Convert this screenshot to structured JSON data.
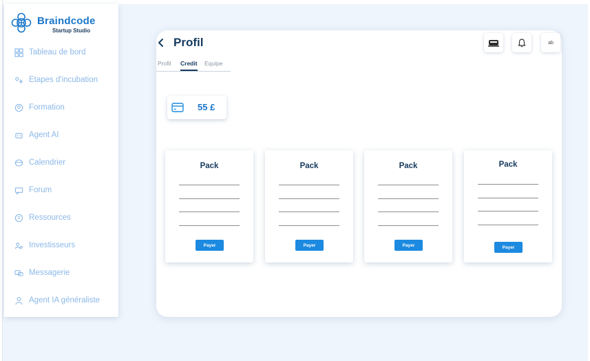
{
  "brand": {
    "name": "Braindcode",
    "subtitle": "Startup Studio",
    "color": "#1976c9"
  },
  "sidebar": {
    "items": [
      {
        "label": "Tableau de bord",
        "icon": "dashboard-icon"
      },
      {
        "label": "Etapes d'incubation",
        "icon": "steps-icon"
      },
      {
        "label": "Formation",
        "icon": "training-icon"
      },
      {
        "label": "Agent AI",
        "icon": "robot-icon"
      },
      {
        "label": "Calendrier",
        "icon": "calendar-icon"
      },
      {
        "label": "Forum",
        "icon": "forum-icon"
      },
      {
        "label": "Ressources",
        "icon": "document-icon"
      },
      {
        "label": "Investisseurs",
        "icon": "investor-icon"
      },
      {
        "label": "Messagerie",
        "icon": "chat-icon"
      },
      {
        "label": "Agent IA généraliste",
        "icon": "user-icon"
      }
    ]
  },
  "header": {
    "title": "Profil",
    "lang_label": "ab"
  },
  "tabs": [
    {
      "label": "Profil",
      "active": false
    },
    {
      "label": "Credit",
      "active": true
    },
    {
      "label": "Equipe",
      "active": false
    }
  ],
  "credit": {
    "amount": "55 £"
  },
  "packs": [
    {
      "title": "Pack",
      "button": "Payer"
    },
    {
      "title": "Pack",
      "button": "Payer"
    },
    {
      "title": "Pack",
      "button": "Payer"
    },
    {
      "title": "Pack",
      "button": "Payer"
    }
  ],
  "colors": {
    "accent": "#1c8ae0",
    "background": "#eef5fd",
    "nav_text": "#8cb8e8",
    "title": "#163a5e"
  }
}
